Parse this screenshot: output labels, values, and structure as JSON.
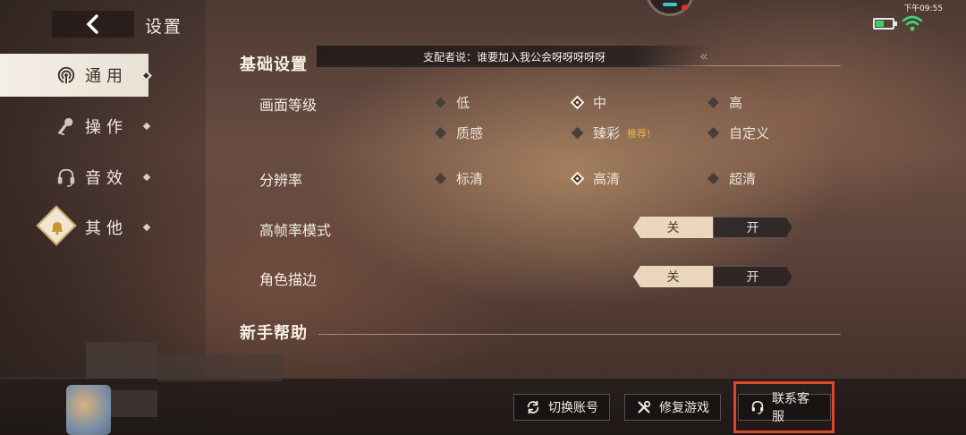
{
  "status": {
    "time": "下午09:55"
  },
  "header": {
    "title": "设置"
  },
  "sidebar": {
    "items": [
      {
        "label": "通用",
        "icon": "wireless-icon"
      },
      {
        "label": "操作",
        "icon": "joystick-icon"
      },
      {
        "label": "音效",
        "icon": "headset-icon"
      },
      {
        "label": "其他",
        "icon": "bell-icon"
      }
    ]
  },
  "basic": {
    "title": "基础设置",
    "banner": "支配者说：谁要加入我公会呀呀呀呀呀",
    "quality": {
      "label": "画面等级",
      "options": [
        "低",
        "中",
        "高",
        "质感",
        "臻彩",
        "自定义"
      ],
      "selected": "中",
      "recommend_tag": "推荐!"
    },
    "resolution": {
      "label": "分辨率",
      "options": [
        "标清",
        "高清",
        "超清"
      ],
      "selected": "高清"
    },
    "high_fps": {
      "label": "高帧率模式",
      "off": "关",
      "on": "开",
      "value": "关"
    },
    "outline": {
      "label": "角色描边",
      "off": "关",
      "on": "开",
      "value": "关"
    }
  },
  "help": {
    "title": "新手帮助"
  },
  "bottom": {
    "switch_account": "切换账号",
    "repair_game": "修复游戏",
    "contact_support": "联系客服"
  },
  "colors": {
    "accent_highlight": "#e0452b",
    "recommend": "#f0b542"
  }
}
